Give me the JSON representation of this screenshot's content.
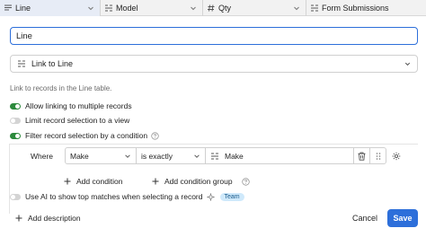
{
  "columns": [
    {
      "label": "Line",
      "icon": "long-text-icon",
      "selected": true
    },
    {
      "label": "Model",
      "icon": "link-field-icon",
      "selected": false
    },
    {
      "label": "Qty",
      "icon": "number-icon",
      "selected": false
    },
    {
      "label": "Form Submissions",
      "icon": "link-field-icon",
      "selected": false
    }
  ],
  "field_name": {
    "value": "Line"
  },
  "field_type": {
    "label": "Link to Line",
    "icon": "link-field-icon"
  },
  "help_text": "Link to records in the Line table.",
  "options": [
    {
      "label": "Allow linking to multiple records",
      "enabled": true
    },
    {
      "label": "Limit record selection to a view",
      "enabled": false
    },
    {
      "label": "Filter record selection by a condition",
      "enabled": true
    }
  ],
  "condition": {
    "where_label": "Where",
    "field": "Make",
    "operator": "is exactly",
    "value": "Make",
    "add_condition": "Add condition",
    "add_condition_group": "Add condition group"
  },
  "ai_option": {
    "label": "Use AI to show top matches when selecting a record",
    "enabled": false,
    "badge": "Team"
  },
  "footer": {
    "add_description": "Add description",
    "cancel": "Cancel",
    "save": "Save"
  },
  "colors": {
    "accent": "#2d6fda",
    "toggle_on": "#2c8a3c",
    "badge_bg": "#cfe9fb"
  }
}
